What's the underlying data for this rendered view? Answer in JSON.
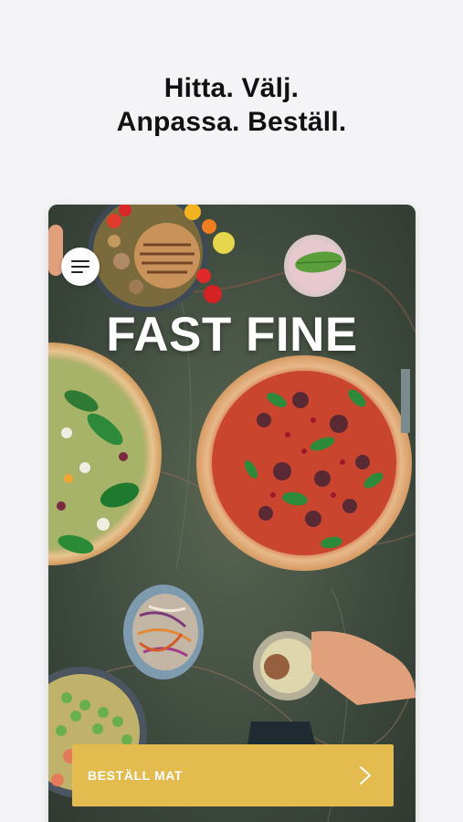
{
  "intro": {
    "line1": "Hitta. Välj.",
    "line2": "Anpassa. Beställ."
  },
  "app": {
    "brand": "FAST FINE",
    "menu_icon": "hamburger-menu-icon",
    "order_button_label": "BESTÄLL MAT",
    "order_button_icon": "chevron-right-icon"
  },
  "colors": {
    "background": "#f4f4f6",
    "cta": "#e4bb4f",
    "brand_text": "#ffffff",
    "headline_text": "#111111"
  }
}
